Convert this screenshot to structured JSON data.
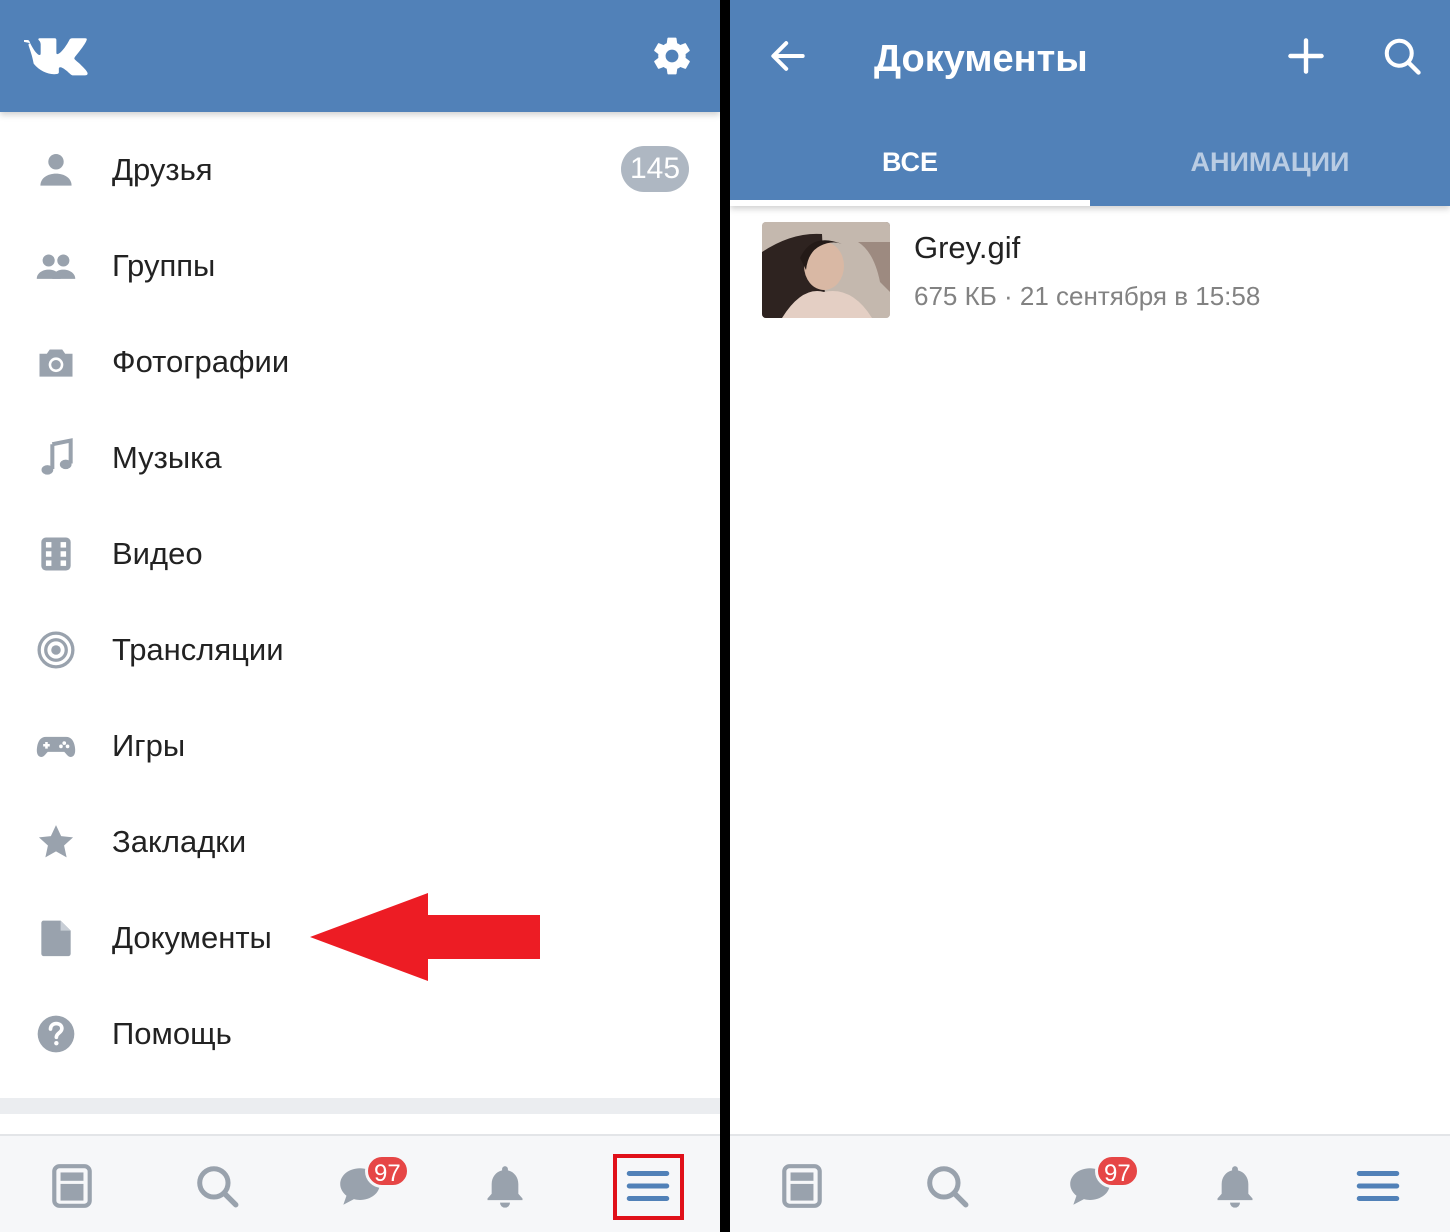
{
  "left": {
    "menu": [
      {
        "label": "Друзья",
        "icon": "person-icon",
        "badge": "145"
      },
      {
        "label": "Группы",
        "icon": "people-icon"
      },
      {
        "label": "Фотографии",
        "icon": "camera-icon"
      },
      {
        "label": "Музыка",
        "icon": "music-note-icon"
      },
      {
        "label": "Видео",
        "icon": "film-icon"
      },
      {
        "label": "Трансляции",
        "icon": "broadcast-icon"
      },
      {
        "label": "Игры",
        "icon": "gamepad-icon"
      },
      {
        "label": "Закладки",
        "icon": "star-icon"
      },
      {
        "label": "Документы",
        "icon": "document-icon"
      },
      {
        "label": "Помощь",
        "icon": "help-icon"
      }
    ]
  },
  "right": {
    "title": "Документы",
    "tabs": [
      "ВСЕ",
      "АНИМАЦИИ"
    ],
    "documents": [
      {
        "name": "Grey.gif",
        "meta": "675 КБ · 21 сентября в 15:58"
      }
    ]
  },
  "bottom_nav": {
    "messages_badge": "97"
  },
  "colors": {
    "header": "#5181b8",
    "badge_red": "#e64646",
    "annotation_red": "#e0101a"
  }
}
